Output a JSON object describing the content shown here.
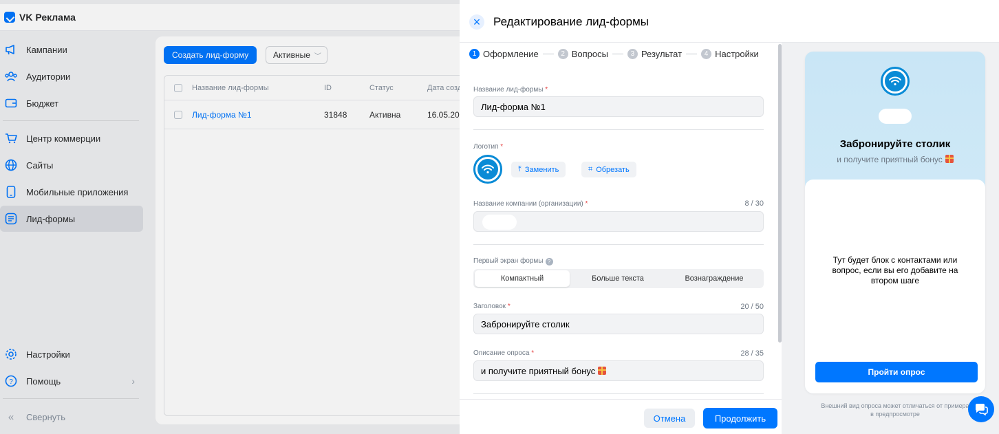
{
  "app": {
    "name": "VK Реклама"
  },
  "sidebar": {
    "items": [
      {
        "label": "Кампании",
        "icon": "megaphone-icon"
      },
      {
        "label": "Аудитории",
        "icon": "people-icon"
      },
      {
        "label": "Бюджет",
        "icon": "wallet-icon"
      },
      {
        "label": "Центр коммерции",
        "icon": "cart-icon"
      },
      {
        "label": "Сайты",
        "icon": "globe-icon"
      },
      {
        "label": "Мобильные приложения",
        "icon": "phone-icon"
      },
      {
        "label": "Лид-формы",
        "icon": "form-icon",
        "active": true
      }
    ],
    "bottom": [
      {
        "label": "Настройки",
        "icon": "gear-icon"
      },
      {
        "label": "Помощь",
        "icon": "help-icon"
      }
    ],
    "collapse_label": "Свернуть"
  },
  "list": {
    "create_button": "Создать лид-форму",
    "filter_label": "Активные",
    "columns": [
      "Название лид-формы",
      "ID",
      "Статус",
      "Дата созд"
    ],
    "rows": [
      {
        "name": "Лид-форма №1",
        "id": "31848",
        "status": "Активна",
        "date": "16.05.202"
      }
    ]
  },
  "panel": {
    "title": "Редактирование лид-формы",
    "steps": [
      {
        "num": "1",
        "label": "Оформление",
        "active": true
      },
      {
        "num": "2",
        "label": "Вопросы"
      },
      {
        "num": "3",
        "label": "Результат"
      },
      {
        "num": "4",
        "label": "Настройки"
      }
    ],
    "form": {
      "name_label": "Название лид-формы",
      "name_value": "Лид-форма №1",
      "logo_label": "Логотип",
      "replace_button": "Заменить",
      "crop_button": "Обрезать",
      "company_label": "Название компании (организации)",
      "company_counter": "8 / 30",
      "first_screen_label": "Первый экран формы",
      "first_screen_options": [
        "Компактный",
        "Больше текста",
        "Вознаграждение"
      ],
      "first_screen_selected": "Компактный",
      "heading_label": "Заголовок",
      "heading_counter": "20 / 50",
      "heading_value": "Забронируйте столик",
      "description_label": "Описание опроса",
      "description_counter": "28 / 35",
      "description_value": "и получите приятный бонус"
    },
    "cancel_button": "Отмена",
    "continue_button": "Продолжить"
  },
  "preview": {
    "title": "Забронируйте столик",
    "subtitle": "и получите приятный бонус",
    "placeholder_text": "Тут будет блок с контактами или вопрос, если вы его добавите на втором шаге",
    "button": "Пройти опрос",
    "note": "Внешний вид опроса может отличаться от примера в предпросмотре"
  },
  "colors": {
    "accent": "#0077ff",
    "logo_ring": "#0a8bd6",
    "required": "#e64646"
  }
}
